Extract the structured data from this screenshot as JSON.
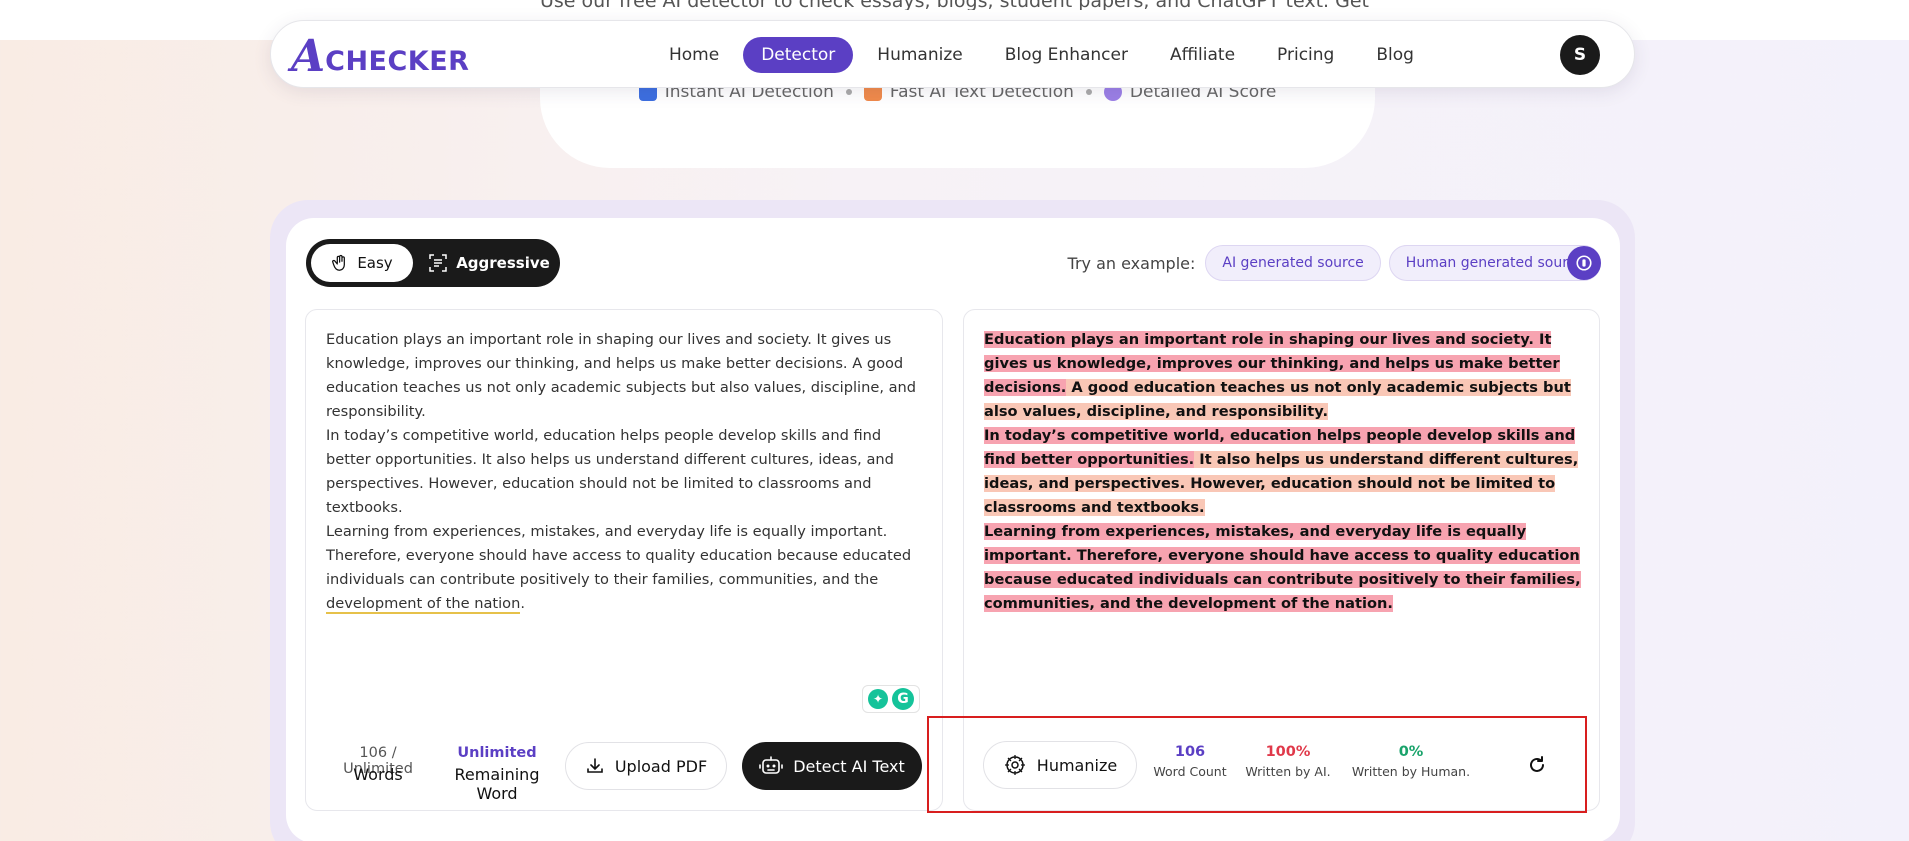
{
  "hero": {
    "subtitle": "Use our free AI detector to check essays, blogs, student papers, and ChatGPT text. Get a clear score",
    "features": [
      {
        "label": "Instant AI Detection",
        "color": "#3d6fe0",
        "icon": "lightning-icon"
      },
      {
        "label": "Fast AI Text Detection",
        "color": "#f08a4b",
        "icon": "ai-chip-icon"
      },
      {
        "label": "Detailed AI Score",
        "color": "#9b7fe6",
        "icon": "score-icon"
      }
    ]
  },
  "nav": {
    "logo_mark": "A",
    "logo_text": "CHECKER",
    "links": [
      "Home",
      "Detector",
      "Humanize",
      "Blog Enhancer",
      "Affiliate",
      "Pricing",
      "Blog"
    ],
    "active": "Detector",
    "avatar": "S"
  },
  "modes": {
    "easy": "Easy",
    "aggressive": "Aggressive",
    "selected": "Easy"
  },
  "examples": {
    "label": "Try an example:",
    "ai_chip": "AI generated source",
    "human_chip": "Human generated source"
  },
  "input": {
    "para1": "Education plays an important role in shaping our lives and society. It gives us knowledge, improves our thinking, and helps us make better decisions. A good education teaches us not only academic subjects but also values, discipline, and responsibility.",
    "para2": " In today’s competitive world, education helps people develop skills and find better opportunities. It also helps us understand different cultures, ideas, and perspectives. However, education should not be limited to classrooms and textbooks.",
    "para3_pre": " Learning from experiences, mistakes, and everyday life is equally important. Therefore, everyone should have access to quality education because educated individuals can contribute positively to their families, communities, and the ",
    "para3_flag": "development of the nation",
    "para3_post": "."
  },
  "input_stats": {
    "words_value": "106 / Unlimited",
    "words_label": "Words",
    "remaining_value": "Unlimited",
    "remaining_label": "Remaining Word"
  },
  "buttons": {
    "upload": "Upload PDF",
    "detect": "Detect AI Text",
    "humanize": "Humanize"
  },
  "result": {
    "s1": "Education plays an important role in shaping our lives and society. It gives us knowledge, improves our thinking, and helps us make better decisions.",
    "s2": " A good education teaches us not only academic subjects but also values, discipline, and responsibility.",
    "s3": "In today’s competitive world, education helps people develop skills and find better opportunities.",
    "s4": " It also helps us understand different cultures, ideas, and perspectives. However, education should not be limited to classrooms and textbooks.",
    "s5": "Learning from experiences, mistakes, and everyday life is equally important. Therefore, everyone should have access to quality education because educated individuals can contribute positively to their families, communities, and the development of the nation.",
    "highlight_colors": {
      "ai": "#f7a3b0",
      "mixed": "#f9c7b6"
    }
  },
  "result_stats": {
    "word_count_value": "106",
    "word_count_label": "Word Count",
    "ai_value": "100%",
    "ai_label": "Written by AI.",
    "human_value": "0%",
    "human_label": "Written by Human."
  },
  "colors": {
    "brand": "#5b3fc4",
    "ai": "#e0394a",
    "human": "#1aa36b",
    "highlight_box": "#d81e1e"
  }
}
